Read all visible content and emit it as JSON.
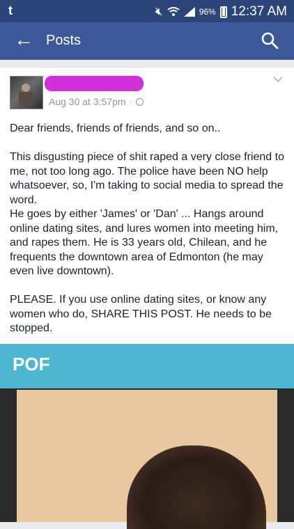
{
  "status_bar": {
    "left_icon": "t",
    "battery": "96%",
    "time": "12:37 AM",
    "icons": [
      "notification-icon",
      "mute-icon",
      "wifi-icon",
      "signal-icon",
      "battery-icon"
    ]
  },
  "app_bar": {
    "title": "Posts",
    "back_icon": "arrow-left-icon",
    "search_icon": "search-icon",
    "background": "#3b5998"
  },
  "post": {
    "timestamp": "Aug 30 at 3:57pm",
    "separator": "·",
    "privacy_icon": "globe-icon",
    "menu_icon": "chevron-down-icon",
    "paragraphs": [
      "Dear friends, friends of friends, and so on..",
      "This disgusting piece of shit raped a very close friend to me, not too long ago. The police have been NO help whatsoever, so, I'm taking to social media to spread the word.\nHe goes by either 'James' or 'Dan' ... Hangs around online dating sites, and lures women into meeting him, and rapes them. He is 33 years old, Chilean, and he frequents the downtown area of Edmonton (he may even live downtown).",
      "PLEASE. If you use online dating sites, or know any women who do, SHARE THIS POST. He needs to be stopped."
    ]
  },
  "attached_image": {
    "header_text": "POF",
    "header_color": "#4fb6d2"
  }
}
